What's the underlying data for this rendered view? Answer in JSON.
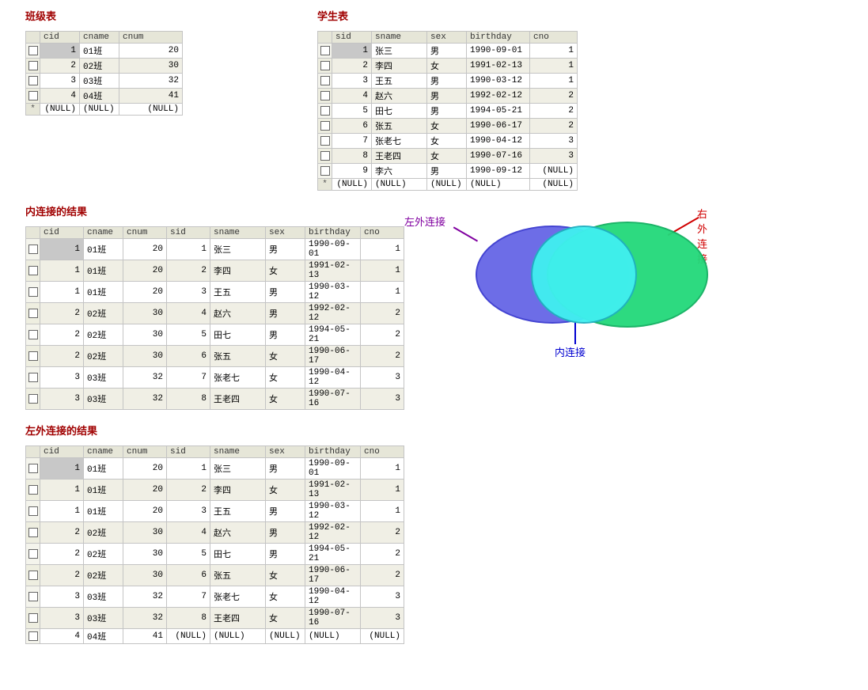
{
  "titles": {
    "class": "班级表",
    "student": "学生表",
    "inner": "内连接的结果",
    "left": "左外连接的结果"
  },
  "venn": {
    "left": "左外连接",
    "right": "右外连接",
    "inner": "内连接"
  },
  "null_text": "(NULL)",
  "star": "*",
  "class_table": {
    "columns": [
      "cid",
      "cname",
      "cnum"
    ],
    "widths": [
      50,
      50,
      80
    ],
    "rows": [
      {
        "cid": "1",
        "cname": "01班",
        "cnum": "20",
        "sel": true
      },
      {
        "cid": "2",
        "cname": "02班",
        "cnum": "30"
      },
      {
        "cid": "3",
        "cname": "03班",
        "cnum": "32"
      },
      {
        "cid": "4",
        "cname": "04班",
        "cnum": "41"
      }
    ],
    "null_row": [
      "(NULL)",
      "(NULL)",
      "(NULL)"
    ]
  },
  "student_table": {
    "columns": [
      "sid",
      "sname",
      "sex",
      "birthday",
      "cno"
    ],
    "widths": [
      50,
      70,
      50,
      80,
      60
    ],
    "rows": [
      {
        "sid": "1",
        "sname": "张三",
        "sex": "男",
        "birthday": "1990-09-01",
        "cno": "1",
        "sel": true
      },
      {
        "sid": "2",
        "sname": "李四",
        "sex": "女",
        "birthday": "1991-02-13",
        "cno": "1"
      },
      {
        "sid": "3",
        "sname": "王五",
        "sex": "男",
        "birthday": "1990-03-12",
        "cno": "1"
      },
      {
        "sid": "4",
        "sname": "赵六",
        "sex": "男",
        "birthday": "1992-02-12",
        "cno": "2"
      },
      {
        "sid": "5",
        "sname": "田七",
        "sex": "男",
        "birthday": "1994-05-21",
        "cno": "2"
      },
      {
        "sid": "6",
        "sname": "张五",
        "sex": "女",
        "birthday": "1990-06-17",
        "cno": "2"
      },
      {
        "sid": "7",
        "sname": "张老七",
        "sex": "女",
        "birthday": "1990-04-12",
        "cno": "3"
      },
      {
        "sid": "8",
        "sname": "王老四",
        "sex": "女",
        "birthday": "1990-07-16",
        "cno": "3"
      },
      {
        "sid": "9",
        "sname": "李六",
        "sex": "男",
        "birthday": "1990-09-12",
        "cno": "(NULL)"
      }
    ],
    "null_row": [
      "(NULL)",
      "(NULL)",
      "(NULL)",
      "(NULL)",
      "(NULL)"
    ]
  },
  "inner_join": {
    "columns": [
      "cid",
      "cname",
      "cnum",
      "sid",
      "sname",
      "sex",
      "birthday",
      "cno"
    ],
    "widths": [
      55,
      50,
      55,
      55,
      70,
      50,
      70,
      55
    ],
    "rows": [
      {
        "cid": "1",
        "cname": "01班",
        "cnum": "20",
        "sid": "1",
        "sname": "张三",
        "sex": "男",
        "birthday": "1990-09-01",
        "cno": "1",
        "sel": true
      },
      {
        "cid": "1",
        "cname": "01班",
        "cnum": "20",
        "sid": "2",
        "sname": "李四",
        "sex": "女",
        "birthday": "1991-02-13",
        "cno": "1"
      },
      {
        "cid": "1",
        "cname": "01班",
        "cnum": "20",
        "sid": "3",
        "sname": "王五",
        "sex": "男",
        "birthday": "1990-03-12",
        "cno": "1"
      },
      {
        "cid": "2",
        "cname": "02班",
        "cnum": "30",
        "sid": "4",
        "sname": "赵六",
        "sex": "男",
        "birthday": "1992-02-12",
        "cno": "2"
      },
      {
        "cid": "2",
        "cname": "02班",
        "cnum": "30",
        "sid": "5",
        "sname": "田七",
        "sex": "男",
        "birthday": "1994-05-21",
        "cno": "2"
      },
      {
        "cid": "2",
        "cname": "02班",
        "cnum": "30",
        "sid": "6",
        "sname": "张五",
        "sex": "女",
        "birthday": "1990-06-17",
        "cno": "2"
      },
      {
        "cid": "3",
        "cname": "03班",
        "cnum": "32",
        "sid": "7",
        "sname": "张老七",
        "sex": "女",
        "birthday": "1990-04-12",
        "cno": "3"
      },
      {
        "cid": "3",
        "cname": "03班",
        "cnum": "32",
        "sid": "8",
        "sname": "王老四",
        "sex": "女",
        "birthday": "1990-07-16",
        "cno": "3"
      }
    ]
  },
  "left_join": {
    "columns": [
      "cid",
      "cname",
      "cnum",
      "sid",
      "sname",
      "sex",
      "birthday",
      "cno"
    ],
    "widths": [
      55,
      50,
      55,
      55,
      70,
      50,
      70,
      55
    ],
    "rows": [
      {
        "cid": "1",
        "cname": "01班",
        "cnum": "20",
        "sid": "1",
        "sname": "张三",
        "sex": "男",
        "birthday": "1990-09-01",
        "cno": "1",
        "sel": true
      },
      {
        "cid": "1",
        "cname": "01班",
        "cnum": "20",
        "sid": "2",
        "sname": "李四",
        "sex": "女",
        "birthday": "1991-02-13",
        "cno": "1"
      },
      {
        "cid": "1",
        "cname": "01班",
        "cnum": "20",
        "sid": "3",
        "sname": "王五",
        "sex": "男",
        "birthday": "1990-03-12",
        "cno": "1"
      },
      {
        "cid": "2",
        "cname": "02班",
        "cnum": "30",
        "sid": "4",
        "sname": "赵六",
        "sex": "男",
        "birthday": "1992-02-12",
        "cno": "2"
      },
      {
        "cid": "2",
        "cname": "02班",
        "cnum": "30",
        "sid": "5",
        "sname": "田七",
        "sex": "男",
        "birthday": "1994-05-21",
        "cno": "2"
      },
      {
        "cid": "2",
        "cname": "02班",
        "cnum": "30",
        "sid": "6",
        "sname": "张五",
        "sex": "女",
        "birthday": "1990-06-17",
        "cno": "2"
      },
      {
        "cid": "3",
        "cname": "03班",
        "cnum": "32",
        "sid": "7",
        "sname": "张老七",
        "sex": "女",
        "birthday": "1990-04-12",
        "cno": "3"
      },
      {
        "cid": "3",
        "cname": "03班",
        "cnum": "32",
        "sid": "8",
        "sname": "王老四",
        "sex": "女",
        "birthday": "1990-07-16",
        "cno": "3"
      },
      {
        "cid": "4",
        "cname": "04班",
        "cnum": "41",
        "sid": "(NULL)",
        "sname": "(NULL)",
        "sex": "(NULL)",
        "birthday": "(NULL)",
        "cno": "(NULL)"
      }
    ]
  },
  "chart_data": {
    "type": "venn",
    "sets": [
      {
        "name": "左外连接",
        "color": "#6666e6"
      },
      {
        "name": "右外连接",
        "color": "#22d97a"
      }
    ],
    "intersection_label": "内连接",
    "intersection_color": "#40f0f0"
  }
}
